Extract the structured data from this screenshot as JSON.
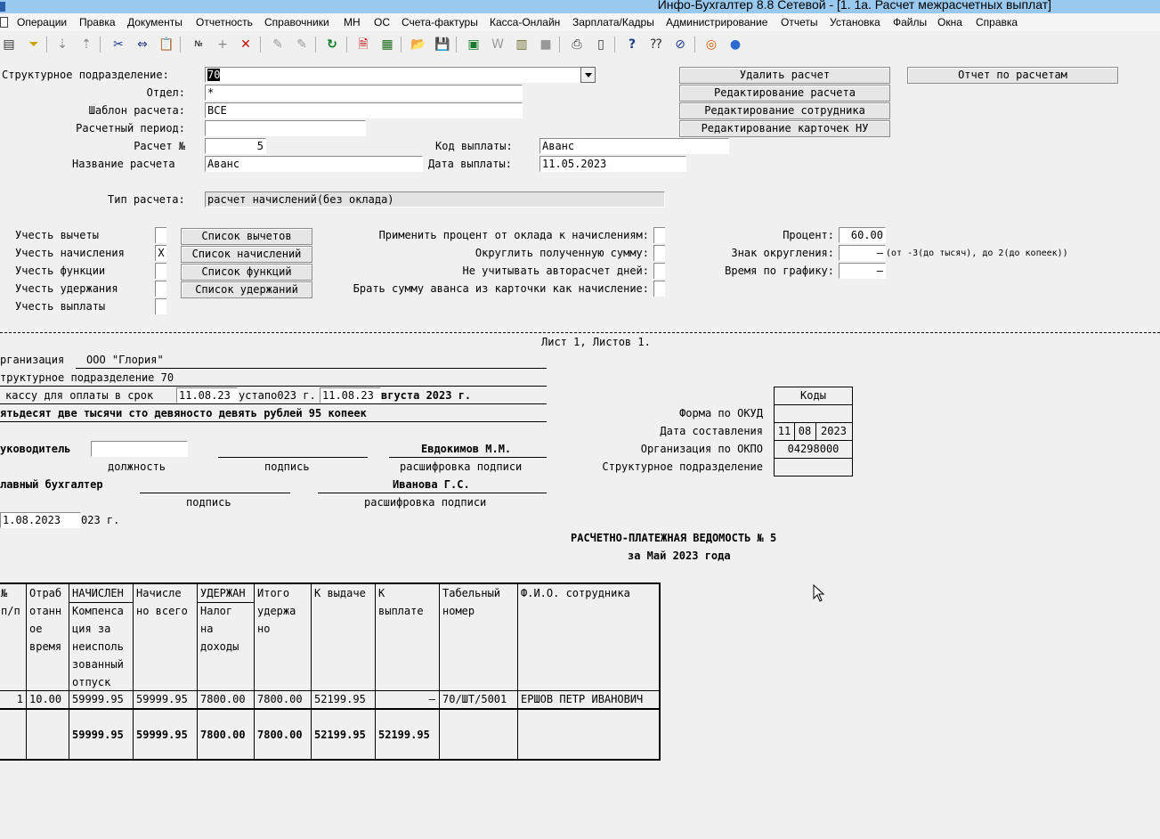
{
  "window": {
    "title": "Инфо-Бухгалтер 8.8 Сетевой - [1. 1а. Расчет межрасчетных выплат]"
  },
  "menu": [
    "Операции",
    "Правка",
    "Документы",
    "Отчетность",
    "Справочники",
    "МН",
    "ОС",
    "Счета-фактуры",
    "Касса-Онлайн",
    "Зарплата/Кадры",
    "Администрирование",
    "Отчеты",
    "Установка",
    "Файлы",
    "Окна",
    "Справка"
  ],
  "toolbar": [
    "list-icon",
    "filter-icon",
    "sort-asc-icon",
    "sort-desc-icon",
    "cut-icon",
    "copy-icon",
    "paste-icon",
    "numbering-icon",
    "add-icon",
    "delete-icon",
    "mark-icon",
    "unmark-icon",
    "refresh-icon",
    "report-icon",
    "calculator-icon",
    "open-folder-icon",
    "save-icon",
    "excel-icon",
    "word-icon",
    "archive-icon",
    "disk-icon",
    "print-icon",
    "preview-icon",
    "help-icon",
    "whats-this-icon",
    "navigator-icon",
    "lifebuoy-icon",
    "globe-icon"
  ],
  "form": {
    "struct_label": "Структурное подразделение:",
    "struct_value": "70",
    "dept_label": "Отдел:",
    "dept_value": "*",
    "template_label": "Шаблон расчета:",
    "template_value": "ВСЕ",
    "period_label": "Расчетный период:",
    "period_value": "",
    "calc_no_label": "Расчет №",
    "calc_no_value": "5",
    "pay_code_label": "Код выплаты:",
    "pay_code_value": "Аванс",
    "calc_name_label": "Название расчета",
    "calc_name_value": "Аванс",
    "pay_date_label": "Дата выплаты:",
    "pay_date_value": "11.05.2023",
    "calc_type_label": "Тип расчета:",
    "calc_type_value": "расчет начислений(без оклада)"
  },
  "buttons": {
    "delete_calc": "Удалить расчет",
    "calc_report": "Отчет по расчетам",
    "edit_calc": "Редактирование расчета",
    "edit_employee": "Редактирование сотрудника",
    "edit_cards": "Редактирование карточек НУ",
    "deductions_list": "Список вычетов",
    "accruals_list": "Список начислений",
    "functions_list": "Список функций",
    "withholdings_list": "Список удержаний"
  },
  "options": {
    "deductions": {
      "label": "Учесть вычеты",
      "value": ""
    },
    "accruals": {
      "label": "Учесть начисления",
      "value": "X"
    },
    "functions": {
      "label": "Учесть функции",
      "value": ""
    },
    "withholdings": {
      "label": "Учесть удержания",
      "value": ""
    },
    "payments": {
      "label": "Учесть выплаты",
      "value": ""
    },
    "apply_percent": {
      "label": "Применить процент от оклада к начислениям:",
      "value": ""
    },
    "round_sum": {
      "label": "Округлить полученную сумму:",
      "value": ""
    },
    "ignore_autocalc": {
      "label": "Не учитывать авторасчет дней:",
      "value": ""
    },
    "advance_from_card": {
      "label": "Брать сумму аванса из карточки как начисление:",
      "value": ""
    },
    "percent_label": "Процент:",
    "percent_value": "60.00",
    "round_sign_label": "Знак округления:",
    "round_sign_value": "–",
    "round_sign_hint": "(от -3(до тысяч), до 2(до копеек))",
    "schedule_time_label": "Время по графику:",
    "schedule_time_value": "–"
  },
  "report": {
    "sheet_info": "Лист 1, Листов 1.",
    "org_label": "рганизация",
    "org_value": "ООО \"Глория\"",
    "struct_line": "труктурное подразделение 70",
    "cash_prefix": "кассу для оплаты в срок",
    "cash_from": "11.08.23",
    "cash_mid": "устапо023 г.",
    "cash_to": "11.08.23",
    "cash_suffix": "вгуста 2023 г.",
    "amount_words": "ятьдесят две тысячи сто девяносто девять рублей 95 копеек",
    "head_label": "уководитель",
    "head_position": "",
    "head_name": "Евдокимов М.М.",
    "caption_position": "должность",
    "caption_signature": "подпись",
    "caption_decoding": "расшифровка подписи",
    "chief_acc_label": "лавный бухгалтер",
    "chief_acc_name": "Иванова Г.С.",
    "caption_signature2": "подпись",
    "caption_decoding2": "расшифровка подписи",
    "date_value": "1.08.2023",
    "date_suffix": "023 г.",
    "codes_header": "Коды",
    "okud_label": "Форма по ОКУД",
    "okud_value": "",
    "comp_date_label": "Дата составления",
    "comp_date_d": "11",
    "comp_date_m": "08",
    "comp_date_y": "2023",
    "okpo_label": "Организация по ОКПО",
    "okpo_value": "04298000",
    "struct_code_label": "Структурное подразделение",
    "struct_code_value": "",
    "doc_title": "РАСЧЕТНО-ПЛАТЕЖНАЯ ВЕДОМОСТЬ № 5",
    "doc_subtitle": "за Май 2023 года"
  },
  "table": {
    "headers": {
      "num": "№ п/п",
      "worked": "Отраб отанн ое время",
      "accrued_group": "НАЧИСЛЕН",
      "accrued_sub": "Компенса ция за неисполь зованный отпуск",
      "accrued_total": "Начисле но всего",
      "withheld_group": "УДЕРЖАН",
      "withheld_sub": "Налог на доходы",
      "withheld_total": "Итого удержа но",
      "to_issue": "К выдаче",
      "to_pay": "К выплате",
      "tab_no": "Табельный номер",
      "fio": "Ф.И.О. сотрудника"
    },
    "row": {
      "num": "1",
      "worked": "10.00",
      "compensation": "59999.95",
      "accrued_total": "59999.95",
      "tax": "7800.00",
      "withheld_total": "7800.00",
      "to_issue": "52199.95",
      "to_pay": "–",
      "tab_no": "70/ШТ/5001",
      "fio": "ЕРШОВ ПЕТР ИВАНОВИЧ"
    },
    "totals": {
      "compensation": "59999.95",
      "accrued_total": "59999.95",
      "tax": "7800.00",
      "withheld_total": "7800.00",
      "to_issue": "52199.95",
      "to_pay": "52199.95"
    }
  }
}
